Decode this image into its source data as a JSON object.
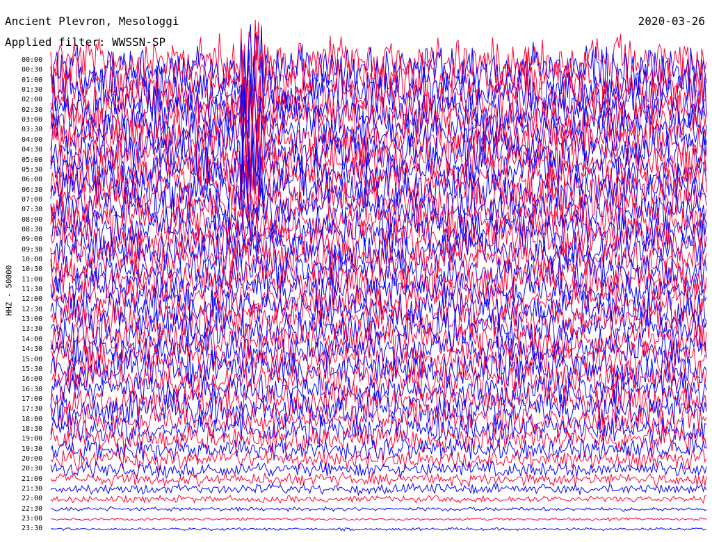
{
  "header": {
    "station": "Ancient Plevron, Mesologgi",
    "filter": "Applied filter: WWSSN-SP",
    "date": "2020-03-26"
  },
  "chart_data": {
    "type": "line",
    "title": "Ancient Plevron, Mesologgi",
    "date": "2020-03-26",
    "filter": "Applied filter: WWSSN-SP",
    "ylabel": "HHZ - 50000",
    "xlabel": "",
    "row_labels": [
      "00:00",
      "00:30",
      "01:00",
      "01:30",
      "02:00",
      "02:30",
      "03:00",
      "03:30",
      "04:00",
      "04:30",
      "05:00",
      "05:30",
      "06:00",
      "06:30",
      "07:00",
      "07:30",
      "08:00",
      "08:30",
      "09:00",
      "09:30",
      "10:00",
      "10:30",
      "11:00",
      "11:30",
      "12:00",
      "12:30",
      "13:00",
      "13:30",
      "14:00",
      "14:30",
      "15:00",
      "15:30",
      "16:00",
      "16:30",
      "17:00",
      "17:30",
      "18:00",
      "18:30",
      "19:00",
      "19:30",
      "20:00",
      "20:30",
      "21:00",
      "21:30",
      "22:00",
      "22:30",
      "23:00",
      "23:30"
    ],
    "trace_colors": [
      "#ff0033",
      "#0000ff"
    ],
    "grid": false,
    "legend": "none"
  }
}
